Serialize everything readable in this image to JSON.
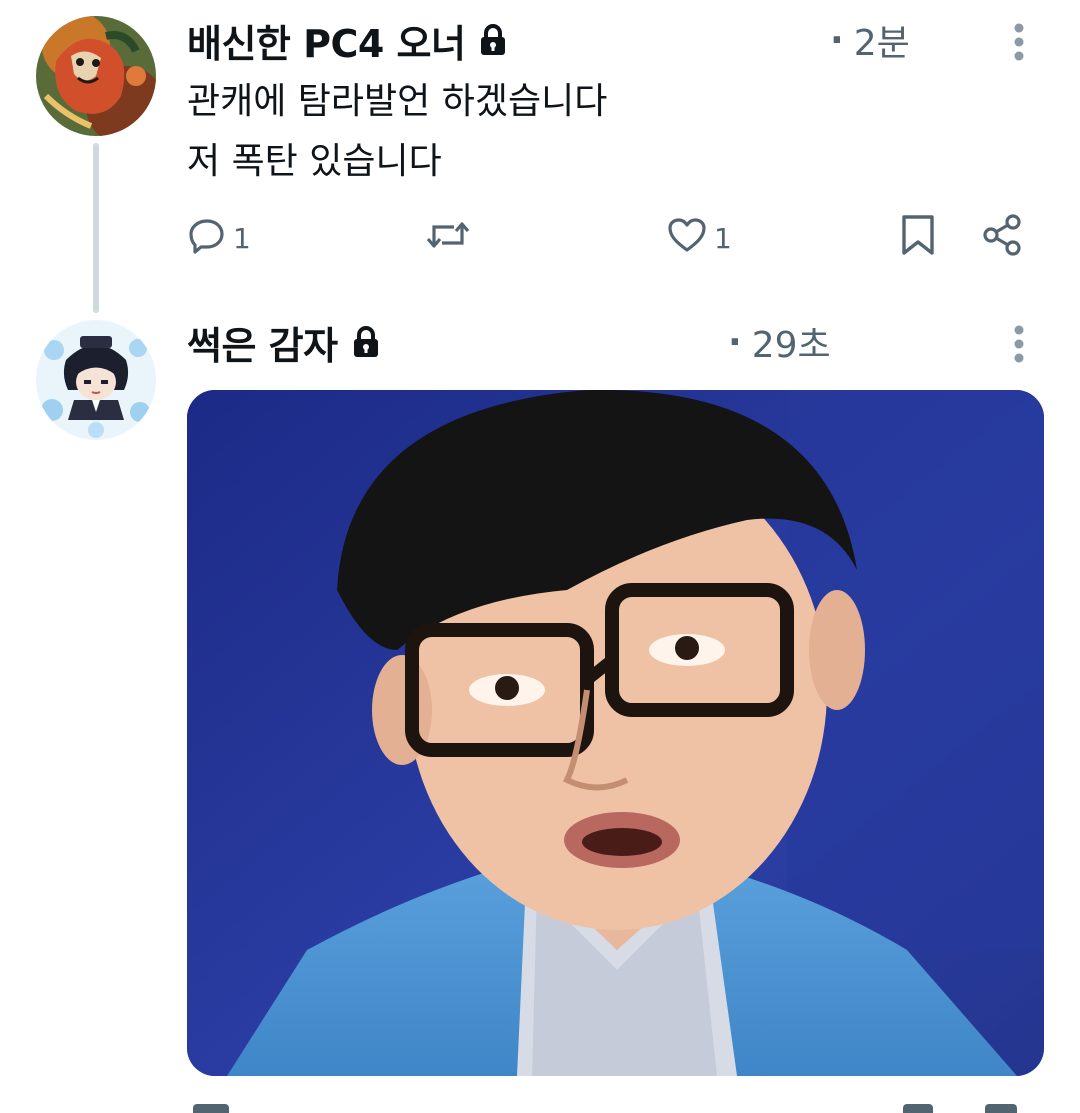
{
  "thread": {
    "posts": [
      {
        "display_name": "배신한 PC4 오너",
        "timestamp": "2분",
        "timestamp_separator": "·",
        "protected_icon": "lock-icon",
        "avatar_icon": "illustrated-demon-face-avatar",
        "text_lines": [
          "관캐에 탐라발언 하겠습니다",
          "저 폭탄 있습니다"
        ],
        "actions": {
          "reply_count": "1",
          "retweet_count": "",
          "like_count": "1"
        }
      },
      {
        "display_name": "썩은 감자",
        "timestamp": "29초",
        "timestamp_separator": "·",
        "protected_icon": "lock-icon",
        "avatar_icon": "chibi-character-avatar",
        "media": {
          "description_icon": "surprised-man-with-glasses-photo"
        }
      }
    ]
  },
  "colors": {
    "text_primary": "#0f1419",
    "text_secondary": "#536471",
    "thread_line": "#cfd9de",
    "background": "#ffffff"
  },
  "icons": [
    "lock-icon",
    "more-vertical-icon",
    "reply-icon",
    "retweet-icon",
    "like-icon",
    "bookmark-icon",
    "share-icon"
  ]
}
